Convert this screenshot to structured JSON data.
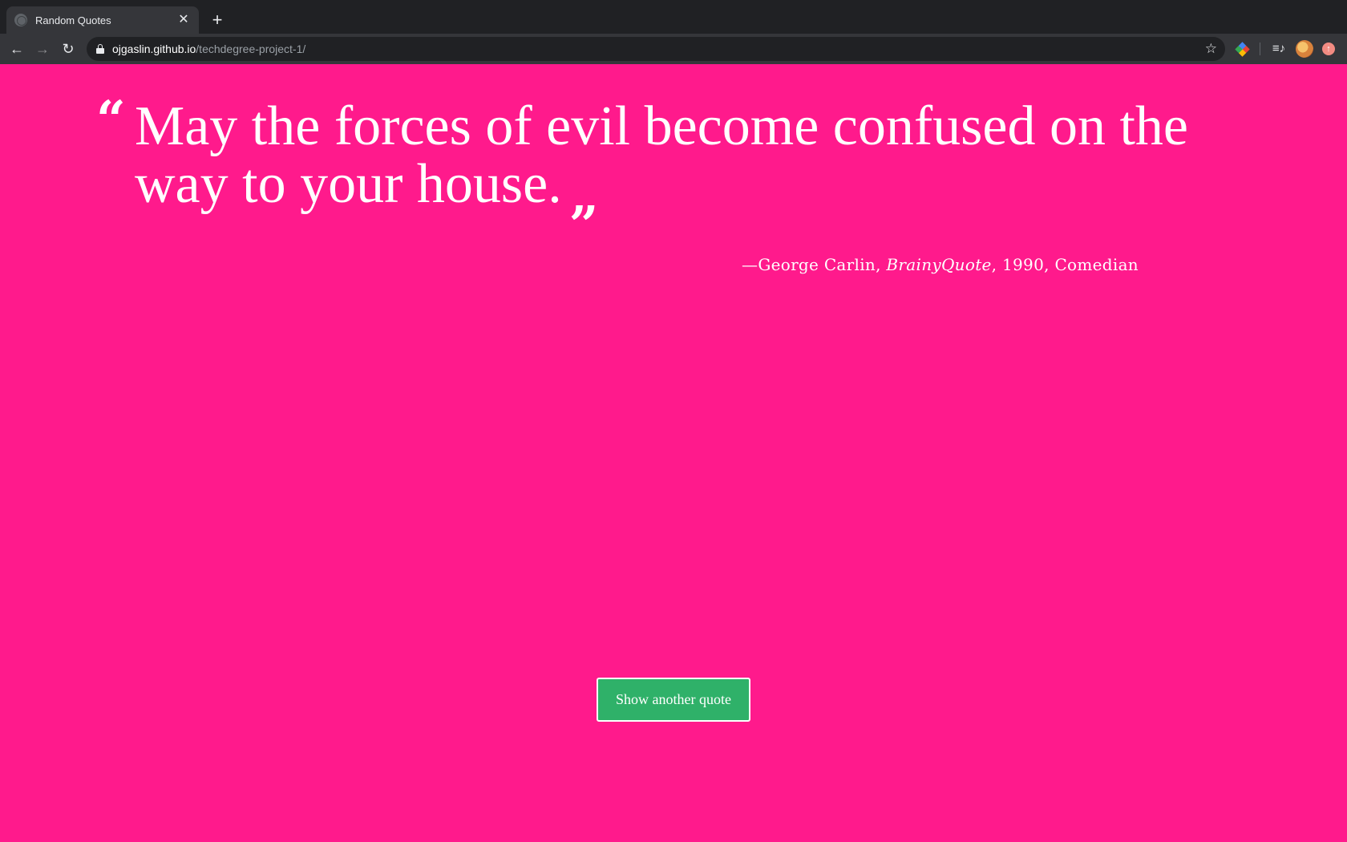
{
  "browser": {
    "tab_title": "Random Quotes",
    "tab_close": "✕",
    "new_tab": "+",
    "url_host": "ojgaslin.github.io",
    "url_path": "/techdegree-project-1/",
    "back_icon": "back-arrow-icon",
    "forward_icon": "forward-arrow-icon",
    "reload_icon": "reload-icon",
    "bookmark_icon": "star-icon"
  },
  "quote": {
    "open_mark": "“",
    "text": "May the forces of evil become confused on the way to your house.",
    "close_mark": "„",
    "dash": "—",
    "author": "George Carlin",
    "citation": "BrainyQuote",
    "year": "1990",
    "tag": "Comedian"
  },
  "button": {
    "label": "Show another quote"
  },
  "colors": {
    "background": "#ff1a8c",
    "button": "#2fb169",
    "text": "#ffffff"
  }
}
